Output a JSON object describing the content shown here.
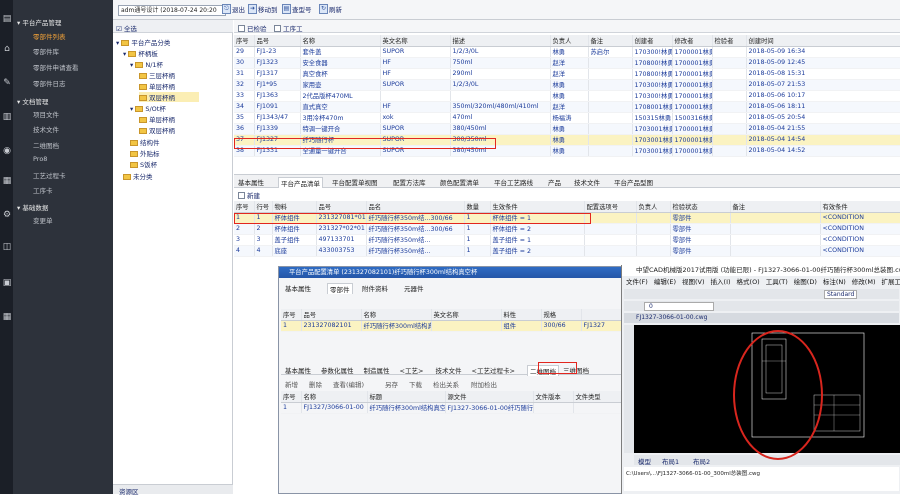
{
  "nav": {
    "sections": [
      {
        "label": "平台产品管理",
        "items": [
          "零部件列表",
          "零部件库",
          "零部件申请查看",
          "零部件日志"
        ],
        "active_index": 0
      },
      {
        "label": "文档管理",
        "items": [
          "项目文件",
          "技术文件",
          "二维图档",
          "Pro8",
          "工艺过程卡",
          "工序卡"
        ]
      },
      {
        "label": "基础数据",
        "items": [
          "变更单"
        ]
      }
    ]
  },
  "toolbar": {
    "user": "adm通号设计 (2018-07-24 20:20",
    "buttons": [
      "退出",
      "移动到",
      "查型号",
      "刷新"
    ],
    "filter_checkboxes": [
      "已检验",
      "工序工"
    ]
  },
  "tree": {
    "header": "全选",
    "nodes": [
      {
        "label": "平台产品分类",
        "level": 0
      },
      {
        "label": "杯柄板",
        "level": 1
      },
      {
        "label": "N/1杯",
        "level": 2
      },
      {
        "label": "三层杯柄",
        "level": 3
      },
      {
        "label": "单层杯柄",
        "level": 3
      },
      {
        "label": "双层杯柄",
        "level": 3,
        "selected": true
      },
      {
        "label": "S/Ot杯",
        "level": 2
      },
      {
        "label": "单层杯柄",
        "level": 3
      },
      {
        "label": "双层杯柄",
        "level": 3
      },
      {
        "label": "结构件",
        "level": 2
      },
      {
        "label": "外贴标",
        "level": 2
      },
      {
        "label": "S饭杯",
        "level": 2
      },
      {
        "label": "未分类",
        "level": 1
      }
    ],
    "footer": "资源区"
  },
  "main_grid": {
    "columns": [
      "序号",
      "品号",
      "名称",
      "英文名称",
      "描述",
      "负责人",
      "备注",
      "创建者",
      "修改者",
      "检验者",
      "创建时间"
    ],
    "rows": [
      [
        "29",
        "FJ1-23",
        "套件盖",
        "SUPOR",
        "1/2/3/0L",
        "林勇",
        "苏启尔",
        "170300!林勇",
        "1700001林勇",
        "",
        "2018-05-09 16:34"
      ],
      [
        "30",
        "FJ1323",
        "安全食器",
        "HF",
        "750ml",
        "赵洋",
        "",
        "170800!林勇",
        "1700001林勇",
        "",
        "2018-05-09 12:45"
      ],
      [
        "31",
        "FJ1317",
        "真空食杯",
        "HF",
        "290ml",
        "赵洋",
        "",
        "170800!林勇",
        "1700001林勇",
        "",
        "2018-05-08 15:31"
      ],
      [
        "32",
        "FJ1*95",
        "家用壶",
        "SUPOR",
        "1/2/3/0L",
        "林勇",
        "",
        "170300!林勇",
        "1700001林勇",
        "",
        "2018-05-07 21:53"
      ],
      [
        "33",
        "FJ1363",
        "2代品版杯470ML",
        "",
        "",
        "林勇",
        "",
        "170300!林勇",
        "1700001林勇",
        "",
        "2018-05-06 10:17"
      ],
      [
        "34",
        "FJ1091",
        "直式真空",
        "HF",
        "350ml/320ml/480ml/410ml",
        "赵洋",
        "",
        "1708001林勇",
        "1700001林勇",
        "",
        "2018-05-06 18:11"
      ],
      [
        "35",
        "FJ1343/47",
        "3用冷杯470m",
        "xok",
        "470ml",
        "杨福涛",
        "",
        "150315林勇",
        "1500316林勇",
        "",
        "2018-05-05 20:54"
      ],
      [
        "36",
        "FJ1339",
        "特调一键开合",
        "SUPOR",
        "380/450ml",
        "林勇",
        "",
        "1703001林勇",
        "1700001林勇",
        "",
        "2018-05-04 21:55"
      ],
      [
        "37",
        "FJ1327",
        "纤巧随行杯",
        "SUPOR",
        "300/350ml",
        "林勇",
        "",
        "1703001林勇",
        "1700001林勇",
        "",
        "2018-05-04 14:54"
      ],
      [
        "38",
        "FJ1331",
        "全通量一键开合",
        "SUPOR",
        "380/450ml",
        "林勇",
        "",
        "1703001林勇",
        "1700001林勇",
        "",
        "2018-05-04 14:52"
      ]
    ],
    "highlight_index": 8
  },
  "detail_tabs": [
    "基本属性",
    "平台产品清单",
    "平台配置单视图",
    "配置方法库",
    "颜色配置清单",
    "平台工艺路线",
    "产品",
    "技术文件",
    "平台产品型图"
  ],
  "detail_active_tab": 1,
  "add_button": "新建",
  "bom_grid": {
    "columns": [
      "序号",
      "行号",
      "物料",
      "品号",
      "品名",
      "数量",
      "生效条件",
      "配置选项号",
      "负责人",
      "检验状态",
      "备注",
      "有效条件"
    ],
    "rows": [
      [
        "1",
        "1",
        "杯体组件",
        "231327081*01",
        "纤巧随行杯350m结...300/66",
        "1",
        "杯体组件 = 1",
        "",
        "",
        "零部件",
        "",
        "<CONDITION"
      ],
      [
        "2",
        "2",
        "杯体组件",
        "231327*02*01",
        "纤巧随行杯350m结...300/66",
        "1",
        "杯体组件 = 2",
        "",
        "",
        "零部件",
        "",
        "<CONDITION"
      ],
      [
        "3",
        "3",
        "盖子组件",
        "497133701",
        "纤巧随行杯350m结...",
        "1",
        "盖子组件 = 1",
        "",
        "",
        "零部件",
        "",
        "<CONDITION"
      ],
      [
        "4",
        "4",
        "底座",
        "433003753",
        "纤巧随行杯350m结...",
        "1",
        "盖子组件 = 2",
        "",
        "",
        "零部件",
        "",
        "<CONDITION"
      ]
    ],
    "highlight_index": 0
  },
  "dialog": {
    "title": "平台产品配置清单 (231327082101)纤巧随行杯300ml结构真空杯",
    "tabs": [
      "基本属性",
      "零部件",
      "附件资料",
      "元器件"
    ],
    "grid_columns": [
      "序号",
      "品号",
      "名称",
      "英文名称",
      "料性",
      "规格"
    ],
    "grid_row": [
      "1",
      "231327082101",
      "纤巧随行杯300ml结构真空杯",
      "",
      "组件",
      "300/66",
      "FJ1327"
    ],
    "lower_tabs": [
      "基本属性",
      "参数化属性",
      "制造属性",
      "<工艺>",
      "技术文件",
      "<工艺过程卡>",
      "二维图档",
      "三维图档"
    ],
    "lower_active_index": 6,
    "lower_toolbar": [
      "新增",
      "删除",
      "查看(编辑)",
      "另存",
      "下载",
      "检出关系",
      "附加检出"
    ],
    "file_columns": [
      "序号",
      "名称",
      "标题",
      "源文件",
      "文件版本",
      "文件类型"
    ],
    "file_row": [
      "1",
      "FJ1327/3066-01-00",
      "纤巧随行杯300ml结构真空杯",
      "FJ1327-3066-01-00纤巧随行杯",
      "",
      ""
    ]
  },
  "cad": {
    "title": "中望CAD机械版2017试用版 (功能已限) - FJ1327-3066-01-00纤巧随行杯300ml总装图.cwg",
    "menu": [
      "文件(F)",
      "编辑(E)",
      "视图(V)",
      "插入(I)",
      "格式(O)",
      "工具(T)",
      "绘图(D)",
      "标注(N)",
      "修改(M)",
      "扩展工具"
    ],
    "layer": "0",
    "style": "Standard",
    "doc_tab": "FJ1327-3066-01-00.cwg",
    "bottom_tabs": [
      "模型",
      "布局1",
      "布局2"
    ],
    "command": "C:\\Users\\...\\FJ1327-3066-01-00_300ml总装图.cwg"
  }
}
